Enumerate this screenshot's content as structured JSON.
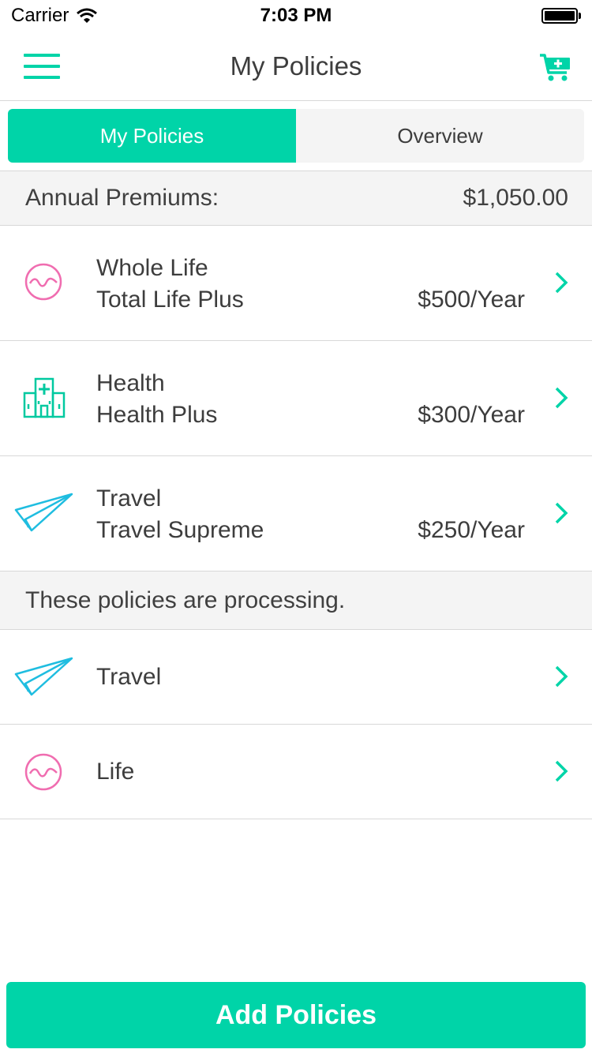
{
  "status_bar": {
    "carrier": "Carrier",
    "time": "7:03 PM"
  },
  "nav": {
    "title": "My Policies"
  },
  "tabs": [
    {
      "label": "My Policies",
      "active": true
    },
    {
      "label": "Overview",
      "active": false
    }
  ],
  "premiums": {
    "label": "Annual Premiums:",
    "amount": "$1,050.00"
  },
  "policies": [
    {
      "type": "Whole Life",
      "plan": "Total Life Plus",
      "price": "$500/Year",
      "icon": "life-wave-icon"
    },
    {
      "type": "Health",
      "plan": "Health Plus",
      "price": "$300/Year",
      "icon": "hospital-icon"
    },
    {
      "type": "Travel",
      "plan": "Travel Supreme",
      "price": "$250/Year",
      "icon": "paper-plane-icon"
    }
  ],
  "processing": {
    "header": "These policies are processing.",
    "items": [
      {
        "label": "Travel",
        "icon": "paper-plane-icon"
      },
      {
        "label": "Life",
        "icon": "life-wave-icon"
      }
    ]
  },
  "add_button": {
    "label": "Add Policies"
  },
  "colors": {
    "accent": "#00d4a8",
    "life_icon": "#f06db0",
    "health_icon": "#00c9a0",
    "travel_icon": "#1fbde0"
  }
}
